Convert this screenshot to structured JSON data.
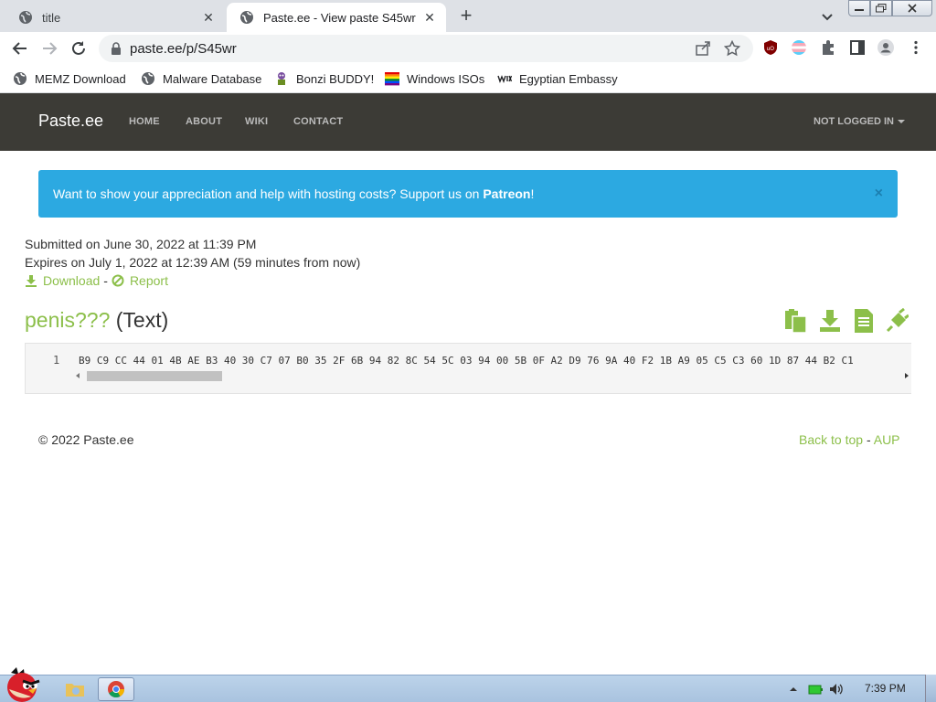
{
  "browser": {
    "tabs": [
      {
        "title": "title",
        "active": false
      },
      {
        "title": "Paste.ee - View paste S45wr",
        "active": true
      }
    ],
    "url": "paste.ee/p/S45wr",
    "bookmarks": [
      {
        "label": "MEMZ Download",
        "icon": "globe-icon"
      },
      {
        "label": "Malware Database",
        "icon": "globe-icon"
      },
      {
        "label": "Bonzi BUDDY!",
        "icon": "bonzi-icon"
      },
      {
        "label": "Windows ISOs",
        "icon": "rainbow-flag-icon"
      },
      {
        "label": "Egyptian Embassy",
        "icon": "wix-icon"
      }
    ]
  },
  "site": {
    "brand": "Paste.ee",
    "nav": [
      "HOME",
      "ABOUT",
      "WIKI",
      "CONTACT"
    ],
    "login": "NOT LOGGED IN",
    "alert": {
      "text": "Want to show your appreciation and help with hosting costs? Support us on ",
      "link": "Patreon",
      "suffix": "!",
      "close": "×"
    },
    "submitted": "Submitted on June 30, 2022 at 11:39 PM",
    "expires": "Expires on July 1, 2022 at 12:39 AM (59 minutes from now)",
    "download_label": "Download",
    "separator": "-",
    "report_label": "Report",
    "paste_name": "penis???",
    "paste_type": "(Text)",
    "code": {
      "line_number": "1",
      "content": "B9 C9 CC 44 01 4B AE B3 40 30 C7 07 B0 35 2F 6B 94 82 8C 54 5C 03 94 00 5B 0F A2 D9 76 9A 40 F2 1B A9 05 C5 C3 60 1D 87 44 B2 C1"
    },
    "footer": {
      "copyright": "© 2022 Paste.ee",
      "back_to_top": "Back to top",
      "separator": "-",
      "aup": "AUP"
    }
  },
  "taskbar": {
    "clock": "7:39 PM"
  },
  "colors": {
    "accent_green": "#8cbf4a",
    "alert_blue": "#2ca9e1",
    "navbar": "#3c3b36"
  }
}
